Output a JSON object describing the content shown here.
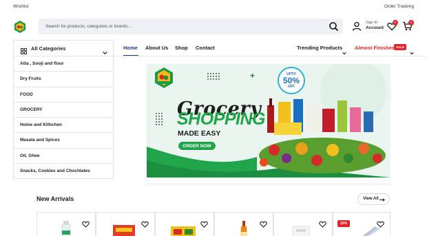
{
  "topbar": {
    "wishlist": "Wishlist",
    "order_tracking": "Order Tracking"
  },
  "header": {
    "search_placeholder": "Search for products, categories or brands...",
    "account_line1": "Sign In",
    "account_line2": "Account",
    "wishlist_count": "0",
    "cart_count": "0"
  },
  "categories": {
    "title": "All Categories",
    "items": [
      "Atta , Sooji and flour",
      "Dry Fruits",
      "FOOD",
      "GROCERY",
      "Home and Kithchen",
      "Masala and Spices",
      "Oil, Ghee",
      "Snacks, Cookies and Chochlates"
    ]
  },
  "nav": {
    "links": [
      "Home",
      "About Us",
      "Shop",
      "Contact"
    ],
    "trending": "Trending Products",
    "almost_finished": "Almost Finished",
    "sale_tag": "SALE"
  },
  "banner": {
    "title_line1": "Grocery",
    "title_line2": "SHOPPING",
    "title_line3": "MADE EASY",
    "button": "ORDER NOW",
    "offer_line1": "UPTO",
    "offer_line2": "50%",
    "offer_line3": "OFF"
  },
  "new_arrivals": {
    "title": "New Arrivals",
    "view_all": "View All",
    "discount_badge": "10%"
  },
  "colors": {
    "accent_red": "#e2242a",
    "brand_green": "#20a54a",
    "nav_blue": "#1b3b7a"
  }
}
